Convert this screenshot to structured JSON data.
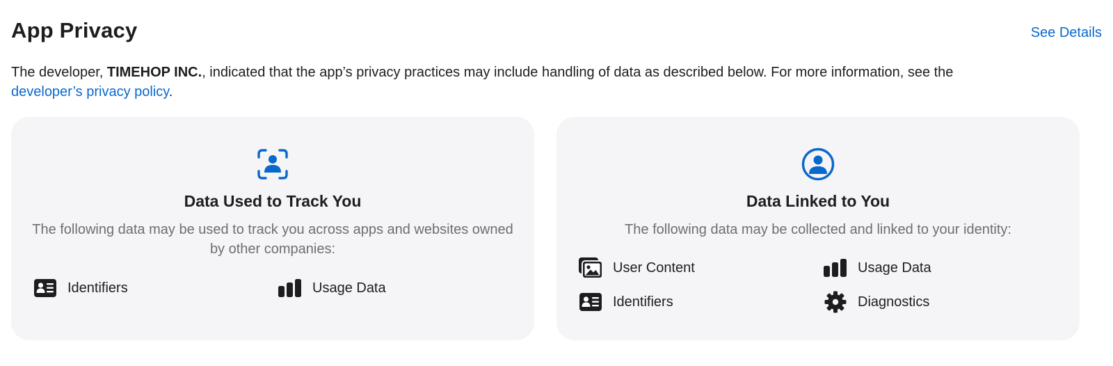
{
  "header": {
    "title": "App Privacy",
    "see_details": "See Details"
  },
  "intro": {
    "prefix": "The developer, ",
    "developer": "TIMEHOP INC.",
    "middle": ", indicated that the app’s privacy practices may include handling of data as described below. For more information, see the ",
    "policy_link": "developer’s privacy policy",
    "suffix": "."
  },
  "cards": [
    {
      "icon": "tracking-person-icon",
      "title": "Data Used to Track You",
      "description": "The following data may be used to track you across apps and websites owned by other companies:",
      "items": [
        {
          "icon": "id-card-icon",
          "label": "Identifiers"
        },
        {
          "icon": "bar-chart-icon",
          "label": "Usage Data"
        }
      ]
    },
    {
      "icon": "person-circle-icon",
      "title": "Data Linked to You",
      "description": "The following data may be collected and linked to your identity:",
      "items": [
        {
          "icon": "photos-icon",
          "label": "User Content"
        },
        {
          "icon": "bar-chart-icon",
          "label": "Usage Data"
        },
        {
          "icon": "id-card-icon",
          "label": "Identifiers"
        },
        {
          "icon": "gear-icon",
          "label": "Diagnostics"
        }
      ]
    }
  ],
  "colors": {
    "accent": "#0a68cc",
    "card_bg": "#f5f5f7",
    "text": "#1d1d1f",
    "secondary_text": "#6e6e73"
  }
}
